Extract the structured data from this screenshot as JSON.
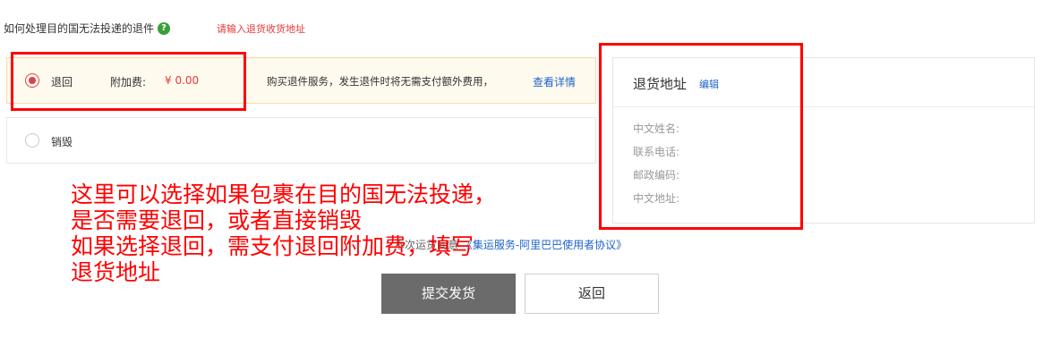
{
  "header": {
    "question": "如何处理目的国无法投递的退件",
    "help_icon": "?",
    "error_hint": "请输入退货收货地址"
  },
  "options": {
    "return": {
      "label": "退回",
      "fee_label": "附加费:",
      "fee_value": "¥ 0.00",
      "service_text": "购买退件服务，发生退件时将无需支付额外费用，",
      "details_link": "查看详情",
      "selected": true
    },
    "destroy": {
      "label": "销毁",
      "selected": false
    }
  },
  "address": {
    "title": "退货地址",
    "edit_label": "编辑",
    "fields": {
      "name": "中文姓名:",
      "phone": "联系电话:",
      "postcode": "邮政编码:",
      "address": "中文地址:"
    }
  },
  "agreement": {
    "prefix": "本次运货同意",
    "link": "《集运服务-阿里巴巴使用者协议》"
  },
  "annotation": {
    "text": "这里可以选择如果包裹在目的国无法投递，\n是否需要退回，或者直接销毁\n如果选择退回，需支付退回附加费，填写\n退货地址"
  },
  "buttons": {
    "submit": "提交发货",
    "back": "返回"
  },
  "colors": {
    "accent_red": "#e4393c",
    "link_blue": "#1e64c8",
    "annotation_red": "#ff0000",
    "help_green": "#37a036",
    "submit_gray": "#6b6b6b"
  }
}
